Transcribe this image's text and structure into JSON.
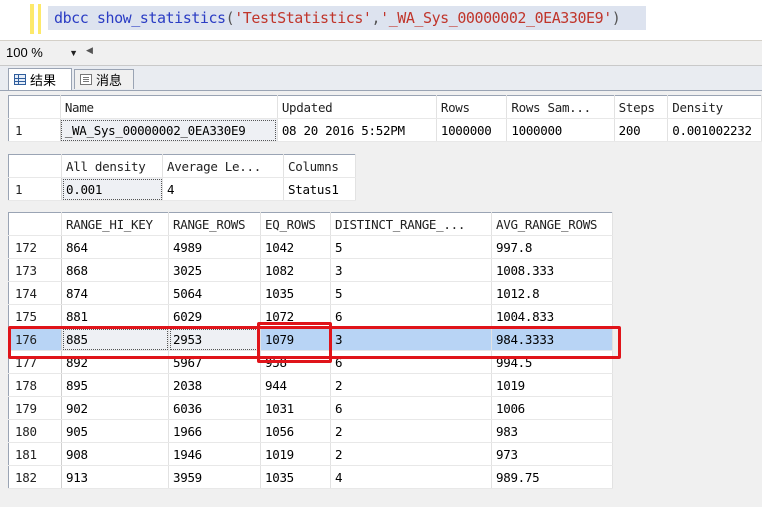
{
  "editor": {
    "keyword": "dbcc show_statistics",
    "arg1": "'TestStatistics'",
    "comma": ",",
    "arg2": "'_WA_Sys_00000002_0EA330E9'",
    "open_paren": "(",
    "close_paren": ")"
  },
  "zoom": {
    "value": "100 %"
  },
  "tabs": [
    {
      "label": "结果",
      "icon": "grid-icon"
    },
    {
      "label": "消息",
      "icon": "messages-icon"
    }
  ],
  "header_grid": {
    "columns": [
      "Name",
      "Updated",
      "Rows",
      "Rows Sam...",
      "Steps",
      "Density"
    ],
    "rows": [
      {
        "num": "1",
        "cells": [
          "_WA_Sys_00000002_0EA330E9",
          "08 20 2016  5:52PM",
          "1000000",
          "1000000",
          "200",
          "0.001002232"
        ]
      }
    ]
  },
  "density_grid": {
    "columns": [
      "All density",
      "Average Le...",
      "Columns"
    ],
    "rows": [
      {
        "num": "1",
        "cells": [
          "0.001",
          "4",
          "Status1"
        ]
      }
    ]
  },
  "histogram_grid": {
    "columns": [
      "RANGE_HI_KEY",
      "RANGE_ROWS",
      "EQ_ROWS",
      "DISTINCT_RANGE_...",
      "AVG_RANGE_ROWS"
    ],
    "selected_row": "176",
    "rows": [
      {
        "num": "172",
        "cells": [
          "864",
          "4989",
          "1042",
          "5",
          "997.8"
        ]
      },
      {
        "num": "173",
        "cells": [
          "868",
          "3025",
          "1082",
          "3",
          "1008.333"
        ]
      },
      {
        "num": "174",
        "cells": [
          "874",
          "5064",
          "1035",
          "5",
          "1012.8"
        ]
      },
      {
        "num": "175",
        "cells": [
          "881",
          "6029",
          "1072",
          "6",
          "1004.833"
        ]
      },
      {
        "num": "176",
        "cells": [
          "885",
          "2953",
          "1079",
          "3",
          "984.3333"
        ]
      },
      {
        "num": "177",
        "cells": [
          "892",
          "5967",
          "958",
          "6",
          "994.5"
        ]
      },
      {
        "num": "178",
        "cells": [
          "895",
          "2038",
          "944",
          "2",
          "1019"
        ]
      },
      {
        "num": "179",
        "cells": [
          "902",
          "6036",
          "1031",
          "6",
          "1006"
        ]
      },
      {
        "num": "180",
        "cells": [
          "905",
          "1966",
          "1056",
          "2",
          "983"
        ]
      },
      {
        "num": "181",
        "cells": [
          "908",
          "1946",
          "1019",
          "2",
          "973"
        ]
      },
      {
        "num": "182",
        "cells": [
          "913",
          "3959",
          "1035",
          "4",
          "989.75"
        ]
      }
    ]
  },
  "colors": {
    "selection": "#b8d4f5",
    "highlight_box": "#e0141a",
    "keyword": "#2b3dc4",
    "string": "#c0352b"
  }
}
